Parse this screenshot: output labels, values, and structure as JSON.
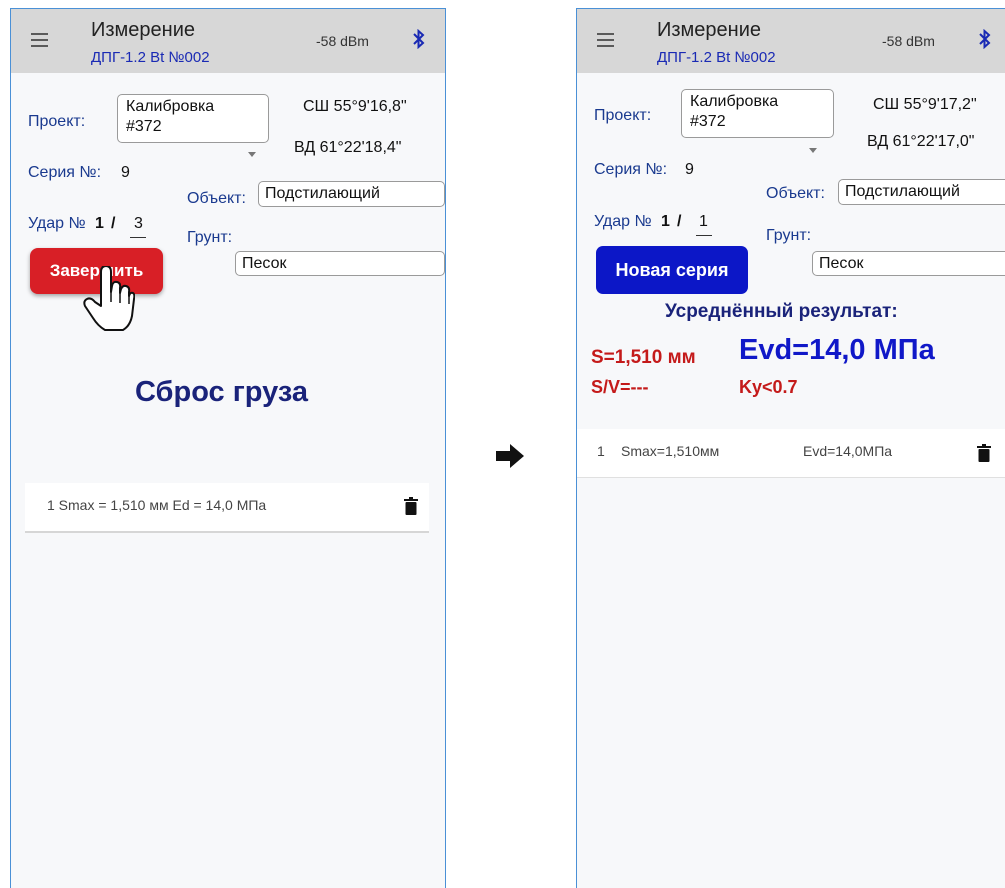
{
  "arrow_icon": "right-arrow-icon",
  "left": {
    "header": {
      "title": "Измерение",
      "subtitle": "ДПГ-1.2 Bt №002",
      "rssi": "-58 dBm",
      "bt_icon": "bluetooth-icon"
    },
    "project_label": "Проект:",
    "project_value_line1": "Калибровка",
    "project_value_line2": "#372",
    "lat": "СШ 55°9'16,8\"",
    "lon": "ВД 61°22'18,4\"",
    "series_label": "Серия №:",
    "series_value": "9",
    "object_label": "Объект:",
    "object_value": "Подстилающий",
    "hit_label": "Удар №",
    "hit_current": "1",
    "hit_separator": "/",
    "hit_total": "3",
    "soil_label": "Грунт:",
    "soil_value": "Песок",
    "finish_button": "Завершить",
    "status_title": "Сброс груза",
    "results": [
      {
        "text": "1  Smax = 1,510 мм   Ed = 14,0 МПа"
      }
    ],
    "cursor_icon": "hand-pointer-icon"
  },
  "right": {
    "header": {
      "title": "Измерение",
      "subtitle": "ДПГ-1.2 Bt №002",
      "rssi": "-58 dBm",
      "bt_icon": "bluetooth-icon"
    },
    "project_label": "Проект:",
    "project_value_line1": "Калибровка",
    "project_value_line2": "#372",
    "lat": "СШ 55°9'17,2\"",
    "lon": "ВД 61°22'17,0\"",
    "series_label": "Серия №:",
    "series_value": "9",
    "object_label": "Объект:",
    "object_value": "Подстилающий",
    "hit_label": "Удар №",
    "hit_current": "1",
    "hit_separator": "/",
    "hit_total": "1",
    "soil_label": "Грунт:",
    "soil_value": "Песок",
    "new_series_button": "Новая серия",
    "avg_title": "Усреднённый результат:",
    "s_value": "S=1,510 мм",
    "evd_value": "Evd=14,0 МПа",
    "sv_value": "S/V=---",
    "ky_value": "Ky<0.7",
    "results": [
      {
        "index": "1",
        "smax": "Smax=1,510мм",
        "evd": "Evd=14,0МПа"
      }
    ]
  },
  "colors": {
    "appbar": "#d7d7d7",
    "subtitle_blue": "#1a2ab4",
    "finish_red": "#d81f26",
    "new_series_blue": "#0c17c7",
    "result_red": "#c41a1a",
    "evd_blue": "#1018c8"
  }
}
